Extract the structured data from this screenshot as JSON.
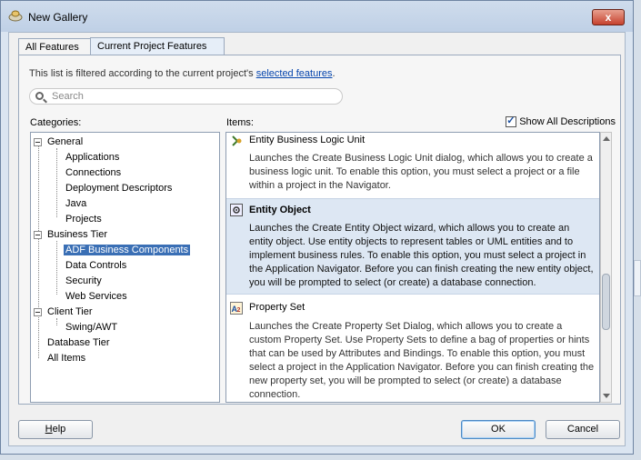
{
  "window": {
    "title": "New Gallery",
    "close_glyph": "x"
  },
  "tabs": [
    {
      "label": "All Features",
      "selected": false
    },
    {
      "label": "Current Project Features",
      "selected": true
    }
  ],
  "filter": {
    "text": "This list is filtered according to the current project's ",
    "link": "selected features",
    "suffix": "."
  },
  "search": {
    "placeholder": "Search"
  },
  "categories": {
    "label": "Categories:",
    "tree": [
      {
        "label": "General",
        "level": 0,
        "expanded": true
      },
      {
        "label": "Applications",
        "level": 1
      },
      {
        "label": "Connections",
        "level": 1
      },
      {
        "label": "Deployment Descriptors",
        "level": 1
      },
      {
        "label": "Java",
        "level": 1
      },
      {
        "label": "Projects",
        "level": 1
      },
      {
        "label": "Business Tier",
        "level": 0,
        "expanded": true
      },
      {
        "label": "ADF Business Components",
        "level": 1,
        "selected": true
      },
      {
        "label": "Data Controls",
        "level": 1
      },
      {
        "label": "Security",
        "level": 1
      },
      {
        "label": "Web Services",
        "level": 1
      },
      {
        "label": "Client Tier",
        "level": 0,
        "expanded": true
      },
      {
        "label": "Swing/AWT",
        "level": 1
      },
      {
        "label": "Database Tier",
        "level": 0
      },
      {
        "label": "All Items",
        "level": 0
      }
    ]
  },
  "items": {
    "label": "Items:",
    "show_all_label": "Show All Descriptions",
    "show_all_checked": true,
    "list": [
      {
        "title": "Entity Business Logic Unit",
        "icon": "business-logic-icon",
        "desc": [
          "Launches the Create Business Logic Unit dialog, which allows you to create a",
          "business logic unit. To enable this option, you must select a project or a file",
          "within a project in the Navigator."
        ]
      },
      {
        "title": "Entity Object",
        "icon": "entity-object-icon",
        "selected": true,
        "desc": [
          "Launches the Create Entity Object wizard, which allows you to create an",
          "entity object. Use entity objects to represent tables or UML entities and to",
          "implement business rules. To enable this option, you must select a project in",
          "the Application Navigator. Before you can finish creating the new entity object,",
          "you will be prompted to select (or create) a database connection."
        ]
      },
      {
        "title": "Property Set",
        "icon": "property-set-icon",
        "desc": [
          "Launches the Create Property Set Dialog, which allows you to create a",
          "custom Property Set. Use Property Sets to define a bag of properties or hints",
          "that can be used by Attributes and Bindings. To enable this option, you must",
          "select a project in the Application Navigator. Before you can finish creating the",
          "new property set, you will be prompted to select (or create) a database",
          "connection."
        ]
      }
    ]
  },
  "footer": {
    "help_h": "H",
    "help_rest": "elp",
    "ok": "OK",
    "cancel": "Cancel"
  }
}
